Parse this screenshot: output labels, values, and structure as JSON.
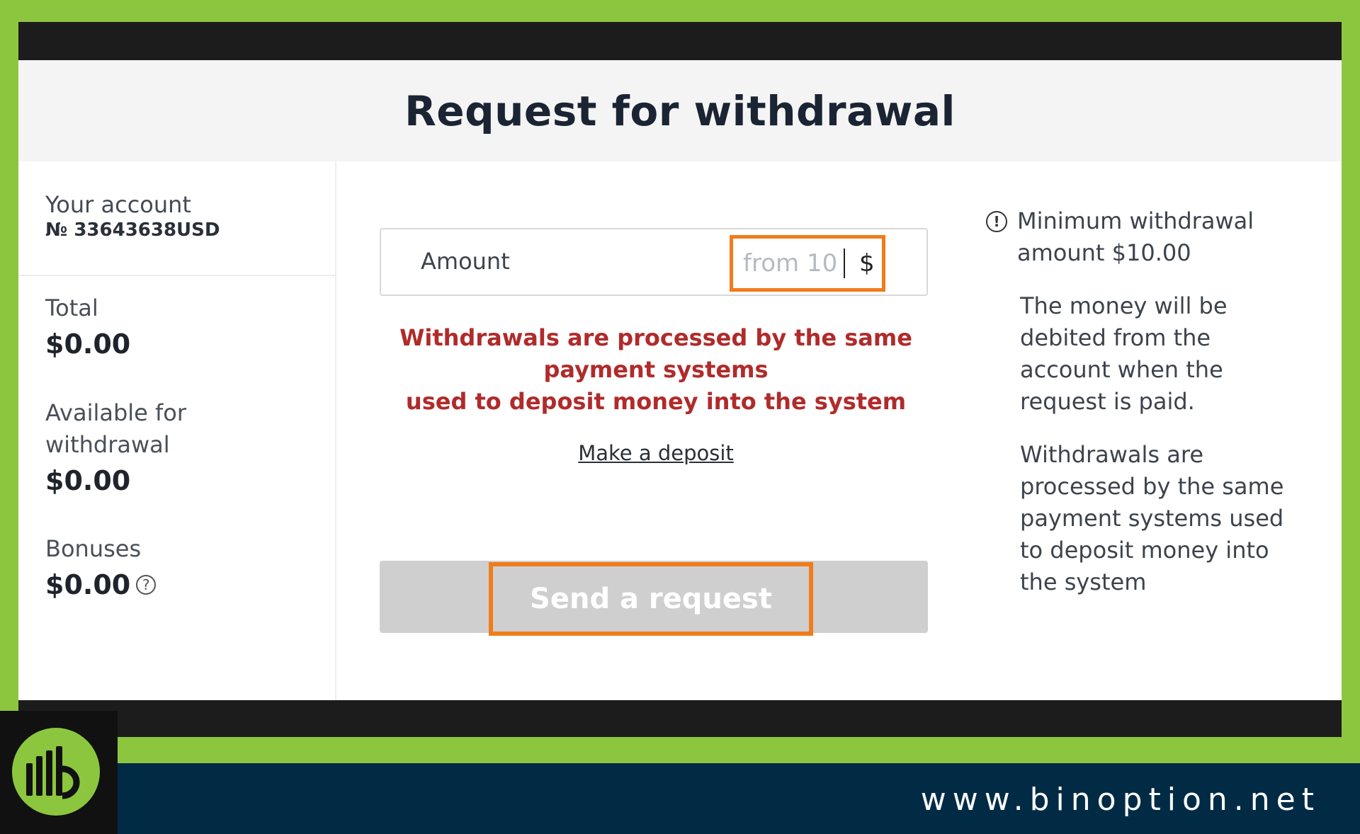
{
  "header": {
    "title": "Request for withdrawal"
  },
  "account": {
    "label": "Your account",
    "number": "№ 33643638USD"
  },
  "stats": {
    "total_label": "Total",
    "total_value": "$0.00",
    "available_label_line1": "Available for",
    "available_label_line2": "withdrawal",
    "available_value": "$0.00",
    "bonuses_label": "Bonuses",
    "bonuses_value": "$0.00",
    "help_glyph": "?"
  },
  "form": {
    "amount_label": "Amount",
    "amount_placeholder": "from 10",
    "currency": "$",
    "warning_line1": "Withdrawals are processed by the same",
    "warning_line2": "payment systems",
    "warning_line3": "used to deposit money into the system",
    "deposit_link": "Make a deposit",
    "send_label": "Send a request"
  },
  "info": {
    "icon_glyph": "!",
    "min_line1": "Minimum withdrawal",
    "min_line2": "amount $10.00",
    "debit_line1": "The money will be",
    "debit_line2": "debited from the",
    "debit_line3": "account when the",
    "debit_line4": "request is paid.",
    "proc_line1": "Withdrawals are",
    "proc_line2": "processed by the same",
    "proc_line3": "payment systems used",
    "proc_line4": "to deposit money into",
    "proc_line5": "the system"
  },
  "footer": {
    "url": "www.binoption.net"
  },
  "colors": {
    "frame_green": "#8cc63f",
    "highlight_orange": "#f07c1c",
    "warning_red": "#b02b2b",
    "footer_navy": "#012b45"
  }
}
